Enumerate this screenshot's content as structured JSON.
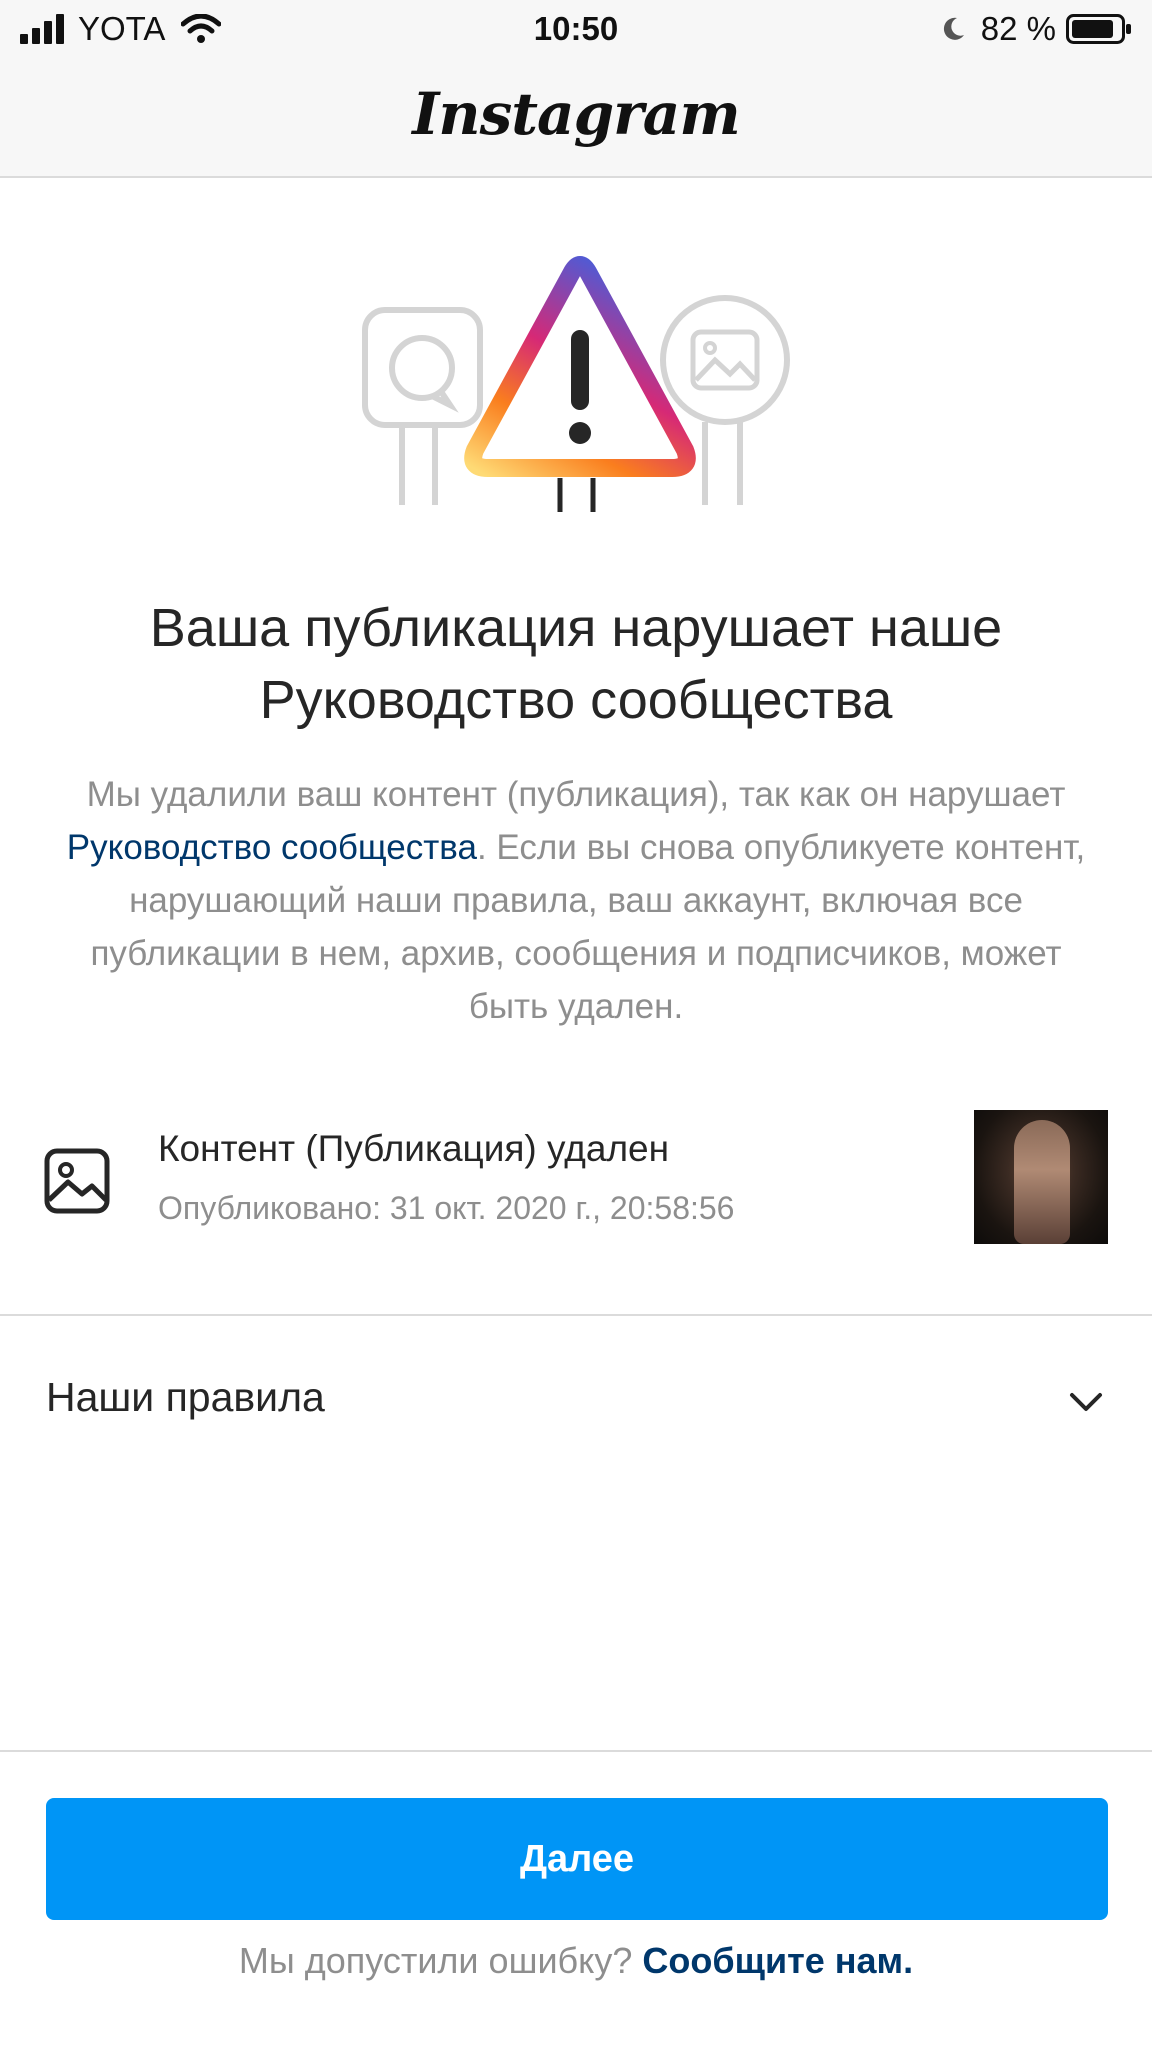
{
  "status_bar": {
    "carrier": "YOTA",
    "time": "10:50",
    "battery": "82 %"
  },
  "header": {
    "title": "Instagram"
  },
  "notice": {
    "headline": "Ваша публикация нарушает наше Руководство сообщества",
    "description_before": "Мы удалили ваш контент (публикация), так как он нарушает ",
    "description_link": "Руководство сообщества",
    "description_after": ". Если вы снова опубликуете контент, нарушающий наши правила, ваш аккаунт, включая все публикации в нем, архив, сообщения и подписчиков, может быть удален."
  },
  "removed_content": {
    "title": "Контент (Публикация) удален",
    "published": "Опубликовано: 31 окт. 2020 г., 20:58:56"
  },
  "rules": {
    "label": "Наши правила"
  },
  "actions": {
    "next_label": "Далее",
    "footer_question": "Мы допустили ошибку?",
    "footer_link": "Сообщите нам."
  },
  "colors": {
    "accent": "#0095f6",
    "link": "#00376b",
    "secondary_text": "#8e8e8e",
    "primary_text": "#262626"
  },
  "icons": [
    "signal-icon",
    "wifi-icon",
    "moon-icon",
    "battery-icon",
    "warning-icon",
    "photo-icon",
    "chevron-down-icon"
  ]
}
